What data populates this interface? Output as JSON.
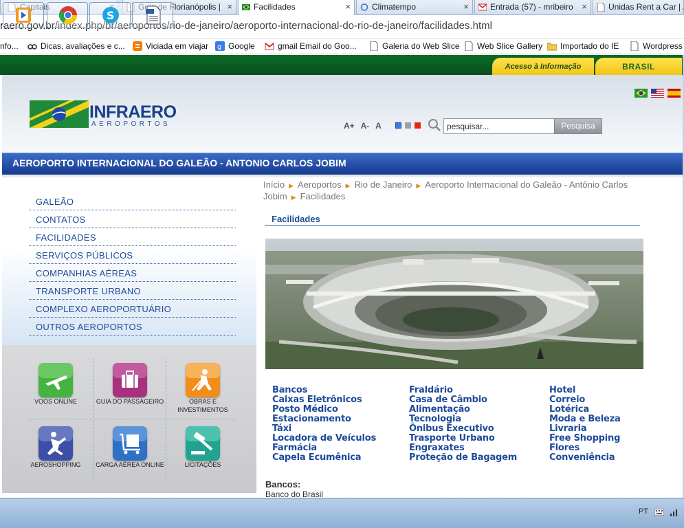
{
  "browser": {
    "tabs": [
      {
        "label": "Capitais",
        "active": false
      },
      {
        "label": "Guia de Florianópolis |",
        "active": false
      },
      {
        "label": "Facilidades",
        "active": true
      },
      {
        "label": "Climatempo",
        "active": false
      },
      {
        "label": "Entrada (57) - mribeiro",
        "active": false
      },
      {
        "label": "Unidas Rent a Car | A",
        "active": false
      }
    ],
    "close_glyph": "×",
    "url_host": "raero.gov.br",
    "url_path": "/index.php/br/aeroportos/rio-de-janeiro/aeroporto-internacional-do-rio-de-janeiro/facilidades.html",
    "bookmarks": [
      "nfo...",
      "Dicas, avaliações e c...",
      "Viciada em viajar",
      "Google",
      "gmail Email do Goo...",
      "Galeria do Web Slice",
      "Web Slice Gallery",
      "Importado do IE",
      "Wordpress"
    ]
  },
  "site": {
    "top_links": {
      "acesso": "Acesso à Informação",
      "brasil": "BRASIL"
    },
    "logo_text": "INFRAERO",
    "logo_sub": "AEROPORTOS",
    "font_controls": [
      "A+",
      "A-",
      "A"
    ],
    "contrast_colors": [
      "#3a7de0",
      "#a0a0a0",
      "#e02a10"
    ],
    "search": {
      "placeholder": "pesquisar...",
      "value": "pesquisar...",
      "button": "Pesquisa"
    },
    "page_title": "AEROPORTO INTERNACIONAL DO GALEÃO - ANTONIO CARLOS JOBIM"
  },
  "nav": {
    "items": [
      "GALEÃO",
      "CONTATOS",
      "FACILIDADES",
      "SERVIÇOS PÚBLICOS",
      "COMPANHIAS AÉREAS",
      "TRANSPORTE URBANO",
      "COMPLEXO AEROPORTUÁRIO",
      "OUTROS AEROPORTOS"
    ],
    "quicklinks": [
      {
        "label": "VOOS ONLINE",
        "icon": "plane-icon",
        "color": "#3fae3a"
      },
      {
        "label": "GUIA DO PASSAGEIRO",
        "icon": "suitcase-icon",
        "color": "#a52a79"
      },
      {
        "label": "OBRAS E INVESTIMENTOS",
        "icon": "worker-icon",
        "color": "#f08b1d"
      },
      {
        "label": "AEROSHOPPING",
        "icon": "shopping-icon",
        "color": "#3b4fa8"
      },
      {
        "label": "CARGA AÉREA ONLINE",
        "icon": "cart-icon",
        "color": "#2c6fc4"
      },
      {
        "label": "LICITAÇÕES",
        "icon": "gavel-icon",
        "color": "#1fa38f"
      }
    ]
  },
  "main": {
    "breadcrumb": [
      "Início",
      "Aeroportos",
      "Rio de Janeiro",
      "Aeroporto Internacional do Galeão - Antônio Carlos Jobim",
      "Facilidades"
    ],
    "breadcrumb_sep": "▶",
    "section_title": "Facilidades",
    "facilities_columns": [
      [
        "Bancos",
        "Caixas Eletrônicos",
        "Posto Médico",
        "Estacionamento",
        "Táxi",
        "Locadora de Veículos",
        "Farmácia",
        "Capela Ecumênica"
      ],
      [
        "Fraldário",
        "Casa de Câmbio",
        "Alimentação",
        "Tecnologia",
        "Ônibus Executivo",
        "Trasporte Urbano",
        "Engraxates",
        "Proteção de Bagagem"
      ],
      [
        "Hotel",
        "Correio",
        "Lotérica",
        "Moda e Beleza",
        "Livraria",
        "Free Shopping",
        "Flores",
        "Conveniência"
      ]
    ],
    "bancos_heading": "Bancos:",
    "bancos_value": "Banco do Brasil"
  },
  "taskbar": {
    "lang": "PT"
  }
}
